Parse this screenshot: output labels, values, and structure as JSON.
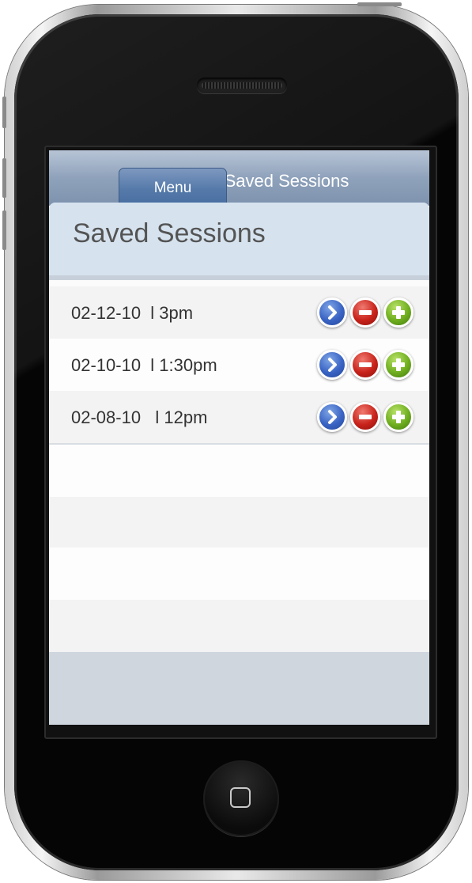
{
  "navbar": {
    "title": "Saved Sessions",
    "menu_label": "Menu"
  },
  "panel": {
    "title": "Saved Sessions"
  },
  "sessions": [
    {
      "label": "02-12-10  l 3pm"
    },
    {
      "label": "02-10-10  l 1:30pm"
    },
    {
      "label": "02-08-10   l 12pm"
    }
  ],
  "row_actions": {
    "open_icon": "chevron-right-icon",
    "delete_icon": "minus-icon",
    "add_icon": "plus-icon"
  },
  "colors": {
    "navbar": "#8fa2bb",
    "panel_header": "#d6e3ef",
    "open_button": "#3a64c4",
    "delete_button": "#c8231b",
    "add_button": "#6fae1f"
  }
}
